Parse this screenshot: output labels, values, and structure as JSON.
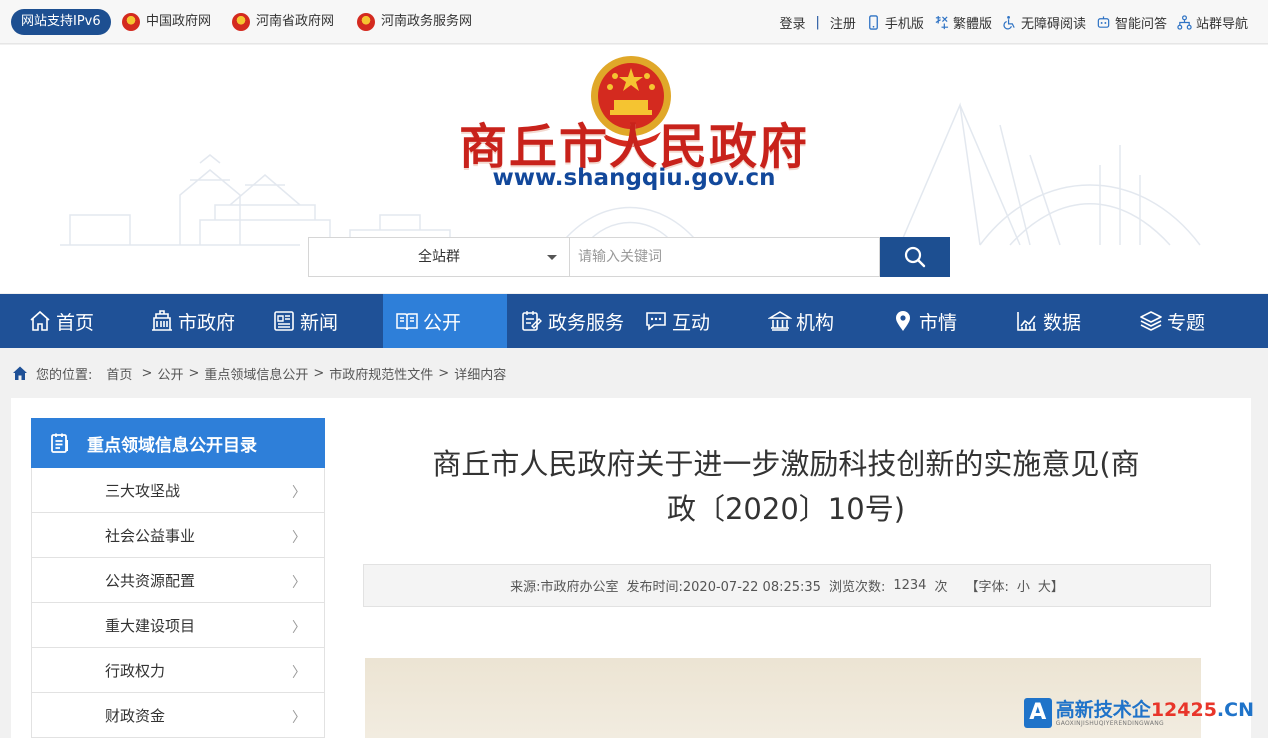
{
  "topbar": {
    "ipv6": "网站支持IPv6",
    "links": [
      {
        "label": "中国政府网"
      },
      {
        "label": "河南省政府网"
      },
      {
        "label": "河南政务服务网"
      }
    ],
    "login": "登录",
    "register": "注册",
    "right": [
      {
        "label": "手机版",
        "icon": "mobile-icon"
      },
      {
        "label": "繁體版",
        "icon": "traditional-chinese-icon"
      },
      {
        "label": "无障碍阅读",
        "icon": "accessibility-icon"
      },
      {
        "label": "智能问答",
        "icon": "robot-icon"
      },
      {
        "label": "站群导航",
        "icon": "sitemap-icon"
      }
    ]
  },
  "header": {
    "title": "商丘市人民政府",
    "url": "www.shangqiu.gov.cn"
  },
  "search": {
    "scope": "全站群",
    "placeholder": "请输入关键词"
  },
  "nav": [
    {
      "label": "首页",
      "icon": "home-icon"
    },
    {
      "label": "市政府",
      "icon": "government-building-icon"
    },
    {
      "label": "新闻",
      "icon": "newspaper-icon"
    },
    {
      "label": "公开",
      "icon": "open-book-icon",
      "active": true
    },
    {
      "label": "政务服务",
      "icon": "service-icon"
    },
    {
      "label": "互动",
      "icon": "chat-icon"
    },
    {
      "label": "机构",
      "icon": "institution-icon"
    },
    {
      "label": "市情",
      "icon": "location-icon"
    },
    {
      "label": "数据",
      "icon": "chart-icon"
    },
    {
      "label": "专题",
      "icon": "layers-icon"
    }
  ],
  "breadcrumb": {
    "label": "您的位置:",
    "items": [
      "首页",
      "公开",
      "重点领域信息公开",
      "市政府规范性文件",
      "详细内容"
    ]
  },
  "sidebar": {
    "title": "重点领域信息公开目录",
    "items": [
      {
        "label": "三大攻坚战"
      },
      {
        "label": "社会公益事业"
      },
      {
        "label": "公共资源配置"
      },
      {
        "label": "重大建设项目"
      },
      {
        "label": "行政权力"
      },
      {
        "label": "财政资金"
      }
    ]
  },
  "article": {
    "title_line1": "商丘市人民政府关于进一步激励科技创新的实施意见(商",
    "title_line2": "政〔2020〕10号)",
    "source": "来源:市政府办公室",
    "published": "发布时间:2020-07-22 08:25:35",
    "views_label": "浏览次数:",
    "views": "1234",
    "views_unit": "次",
    "font_label": "【字体:",
    "font_small": "小",
    "font_large": "大】"
  },
  "watermark": {
    "logo": "A",
    "name": "高新技术企",
    "number": "12425",
    "domain": ".CN",
    "sub": "GAOXINJISHUQIYERENDINGWANG"
  },
  "colors": {
    "primary": "#1f5197",
    "active": "#2e7fd9",
    "title_red": "#c8221b"
  }
}
